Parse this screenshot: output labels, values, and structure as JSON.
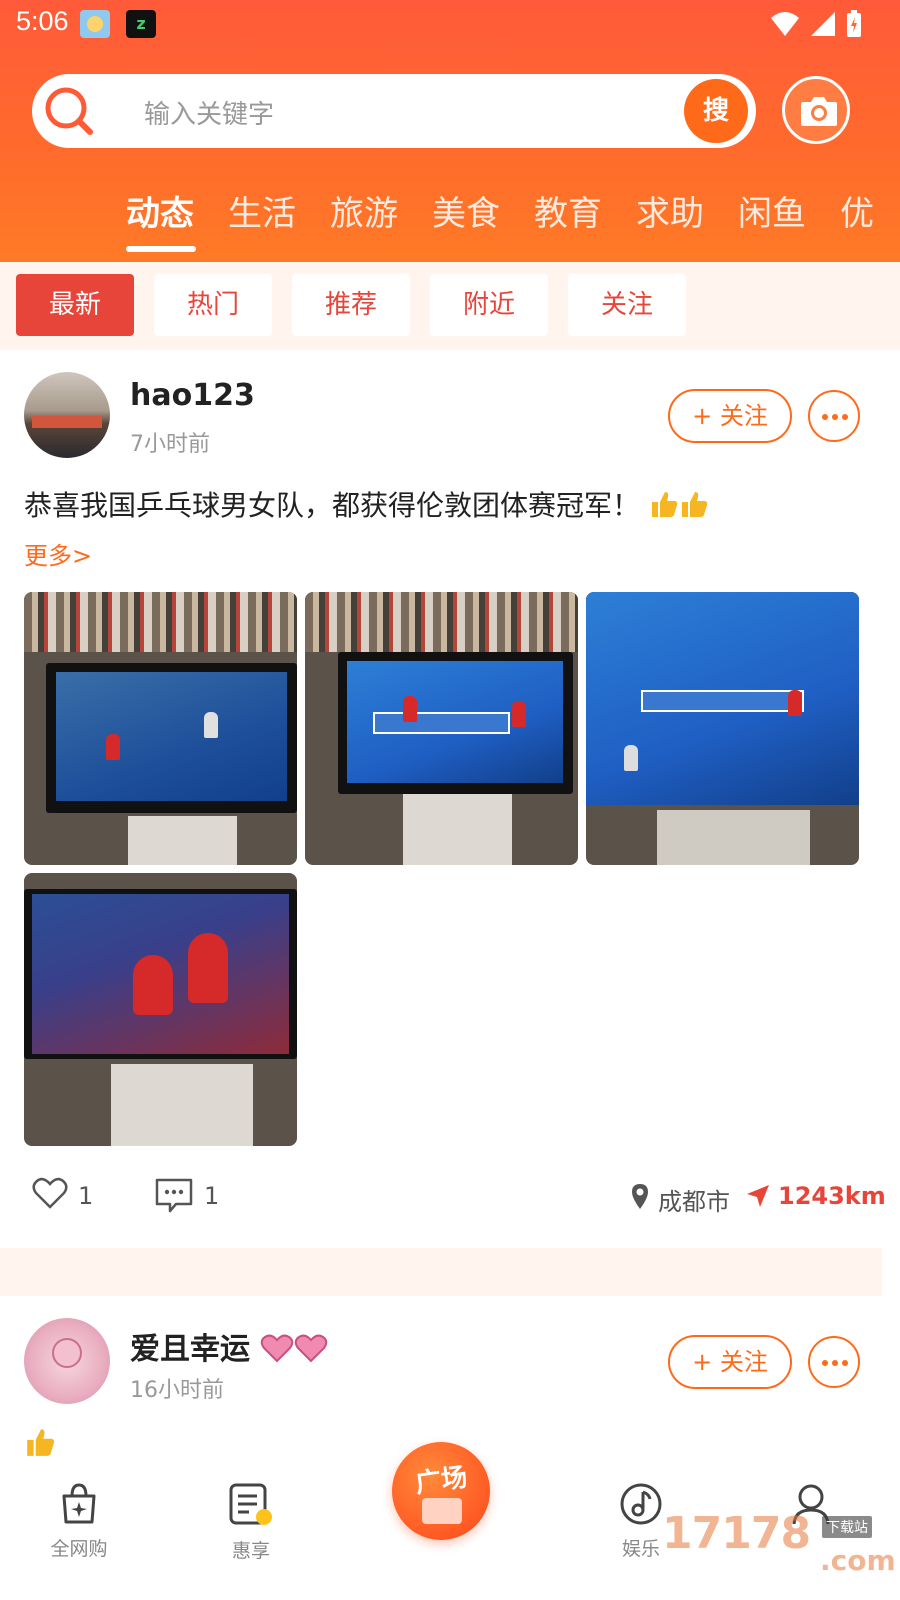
{
  "status_bar": {
    "time": "5:06"
  },
  "search": {
    "placeholder": "输入关键字",
    "button_label": "搜"
  },
  "category_tabs": [
    "动态",
    "生活",
    "旅游",
    "美食",
    "教育",
    "求助",
    "闲鱼",
    "优"
  ],
  "active_category": "动态",
  "filters": [
    "最新",
    "热门",
    "推荐",
    "附近",
    "关注"
  ],
  "active_filter": "最新",
  "posts": [
    {
      "username": "hao123",
      "time": "7小时前",
      "follow_label": "+ 关注",
      "text": "恭喜我国乒乓球男女队，都获得伦敦团体赛冠军！",
      "emoji": "thumbs-up x2",
      "more_label": "更多>",
      "photo_count": 4,
      "likes": "1",
      "comments": "1",
      "city": "成都市",
      "distance": "1243km"
    },
    {
      "username": "爱且幸运",
      "time": "16小时前",
      "follow_label": "+ 关注",
      "emoji": "thumbs-up"
    }
  ],
  "bottom_nav": [
    {
      "label": "全网购",
      "icon": "shopping-bag-icon"
    },
    {
      "label": "惠享",
      "icon": "coupon-list-icon"
    },
    {
      "label": "广场",
      "icon": "plaza-icon"
    },
    {
      "label": "娱乐",
      "icon": "music-icon"
    }
  ],
  "watermark": {
    "main": "17178",
    "sub": "下载站",
    "domain": ".com"
  },
  "colors": {
    "brand": "#ff6a1a",
    "accent_red": "#e8453a",
    "header_top": "#ff5a3a"
  }
}
